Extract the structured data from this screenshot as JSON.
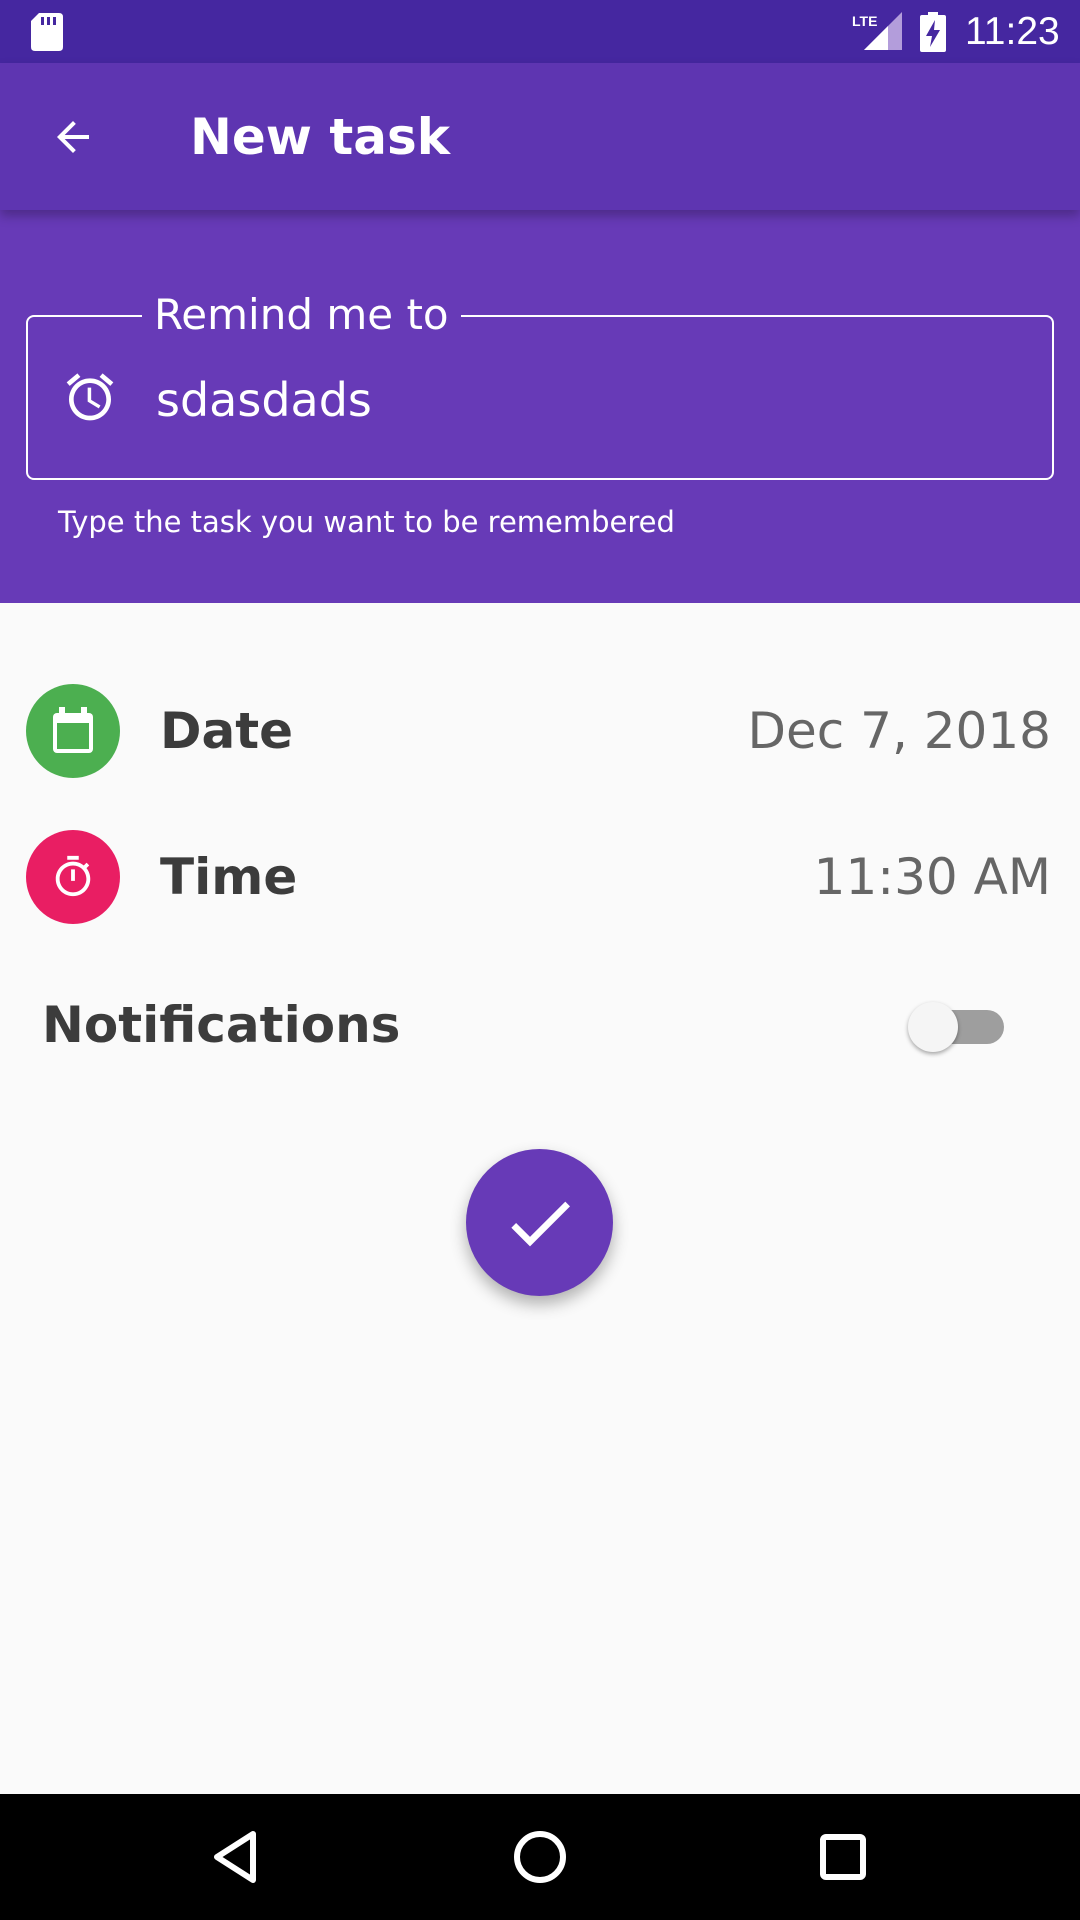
{
  "status_bar": {
    "time": "11:23",
    "network_label": "LTE",
    "icons": [
      "sd-card-icon",
      "lte-signal-icon",
      "battery-charging-icon"
    ]
  },
  "app_bar": {
    "title": "New task",
    "back_icon": "arrow-back-icon"
  },
  "reminder": {
    "label": "Remind me to",
    "value": "sdasdads",
    "helper_text": "Type the task you want to be remembered",
    "icon": "alarm-clock-icon"
  },
  "date_row": {
    "label": "Date",
    "value": "Dec 7, 2018",
    "icon": "calendar-icon",
    "icon_color": "#4caf50"
  },
  "time_row": {
    "label": "Time",
    "value": "11:30 AM",
    "icon": "stopwatch-icon",
    "icon_color": "#e91e63"
  },
  "notifications": {
    "label": "Notifications",
    "enabled": false
  },
  "fab": {
    "icon": "check-icon"
  },
  "nav_bar": {
    "buttons": [
      "back-triangle-icon",
      "home-circle-icon",
      "recents-square-icon"
    ]
  },
  "colors": {
    "status_bar": "#4527a0",
    "app_bar": "#5e35b1",
    "header": "#673ab7",
    "accent": "#673ab7",
    "background": "#fafafa"
  }
}
